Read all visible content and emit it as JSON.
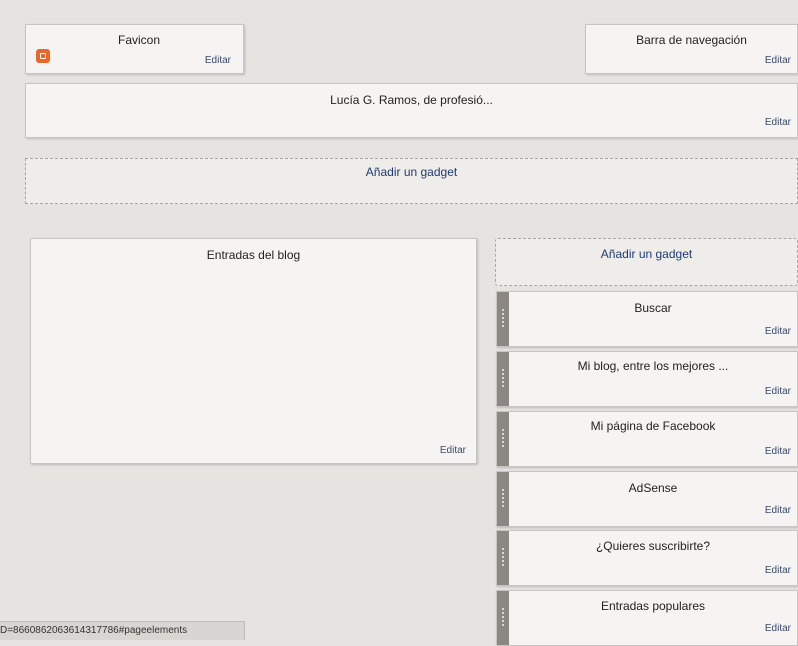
{
  "header_row": {
    "favicon": {
      "title": "Favicon",
      "edit": "Editar",
      "icon": "blogger-icon"
    },
    "navbar": {
      "title": "Barra de navegación",
      "edit": "Editar"
    }
  },
  "header": {
    "title": "Lucía G. Ramos, de profesió...",
    "edit": "Editar"
  },
  "add_gadget_top": {
    "label": "Añadir un gadget"
  },
  "main": {
    "title": "Entradas del blog",
    "edit": "Editar"
  },
  "sidebar": {
    "add_gadget": {
      "label": "Añadir un gadget"
    },
    "items": [
      {
        "title": "Buscar",
        "edit": "Editar"
      },
      {
        "title": "Mi blog, entre los mejores ...",
        "edit": "Editar"
      },
      {
        "title": "Mi página de Facebook",
        "edit": "Editar"
      },
      {
        "title": "AdSense",
        "edit": "Editar"
      },
      {
        "title": "¿Quieres suscribirte?",
        "edit": "Editar"
      },
      {
        "title": "Entradas populares",
        "edit": "Editar"
      }
    ]
  },
  "status_bar": {
    "text": "D=8660862063614317786#pageelements"
  }
}
